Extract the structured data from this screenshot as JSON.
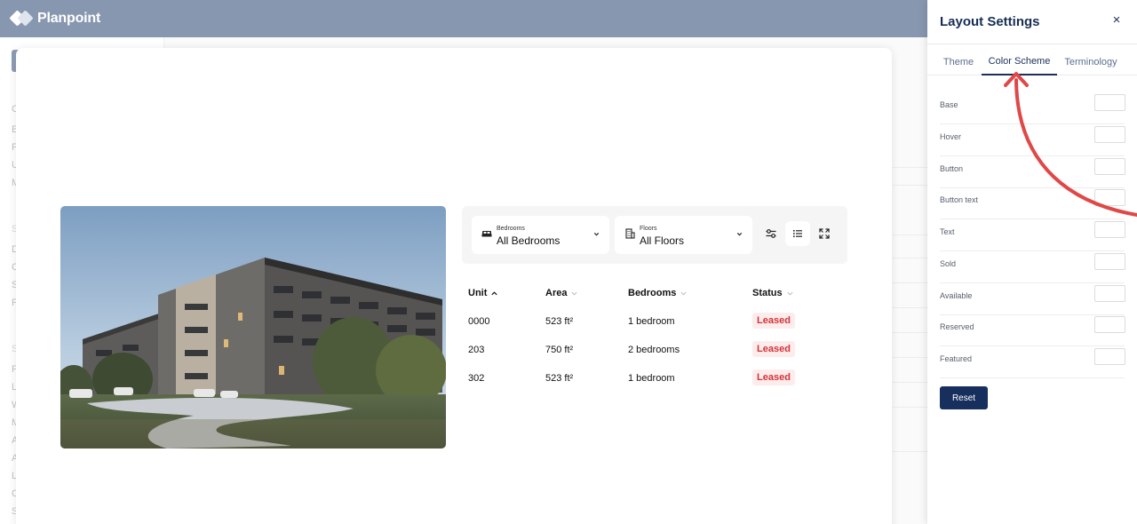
{
  "app": {
    "brand": "Planpoint"
  },
  "filters": {
    "bedrooms": {
      "label": "Bedrooms",
      "value": "All Bedrooms"
    },
    "floors": {
      "label": "Floors",
      "value": "All Floors"
    }
  },
  "units_table": {
    "headers": [
      "Unit",
      "Area",
      "Bedrooms",
      "Status"
    ],
    "rows": [
      {
        "unit": "0000",
        "area": "523 ft²",
        "bedrooms": "1 bedroom",
        "status": "Leased"
      },
      {
        "unit": "203",
        "area": "750 ft²",
        "bedrooms": "2 bedrooms",
        "status": "Leased"
      },
      {
        "unit": "302",
        "area": "523 ft²",
        "bedrooms": "1 bedroom",
        "status": "Leased"
      }
    ]
  },
  "drawer": {
    "title": "Layout Settings",
    "close_icon": "×",
    "tabs": [
      {
        "label": "Theme",
        "active": false
      },
      {
        "label": "Color Scheme",
        "active": true
      },
      {
        "label": "Terminology",
        "active": false
      }
    ],
    "colors": [
      {
        "label": "Base"
      },
      {
        "label": "Hover"
      },
      {
        "label": "Button"
      },
      {
        "label": "Button text"
      },
      {
        "label": "Text"
      },
      {
        "label": "Sold"
      },
      {
        "label": "Available"
      },
      {
        "label": "Reserved"
      },
      {
        "label": "Featured"
      }
    ],
    "reset_label": "Reset"
  },
  "icons": {
    "logo": "planpoint-logo-icon",
    "bed": "bed-icon",
    "building": "building-icon",
    "chevron": "chevron-down-icon",
    "sliders": "sliders-icon",
    "list": "list-icon",
    "expand": "expand-icon",
    "close": "close-icon"
  },
  "colors": {
    "topbar": "#8797b0",
    "brand_navy": "#182d55",
    "leased_text": "#d3343b",
    "leased_bg": "#fdecec",
    "annotation_red": "#e04848"
  }
}
